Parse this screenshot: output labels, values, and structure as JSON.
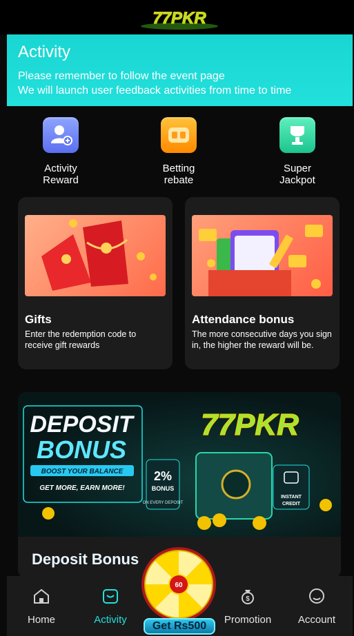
{
  "header": {
    "logo_text": "77PKR"
  },
  "hero": {
    "title": "Activity",
    "line1": "Please remember to follow the event page",
    "line2": "We will launch user feedback activities from time to time"
  },
  "quick_links": [
    {
      "label_line1": "Activity",
      "label_line2": "Reward",
      "icon": "user-add-icon",
      "color": "#6f86ff"
    },
    {
      "label_line1": "Betting",
      "label_line2": "rebate",
      "icon": "rebate-icon",
      "color": "#ff9c1a"
    },
    {
      "label_line1": "Super",
      "label_line2": "Jackpot",
      "icon": "trophy-icon",
      "color": "#2fd9a6"
    }
  ],
  "cards": [
    {
      "title": "Gifts",
      "desc": "Enter the redemption code to receive gift rewards"
    },
    {
      "title": "Attendance bonus",
      "desc": "The more consecutive days you sign in, the higher the reward will be."
    }
  ],
  "promo": {
    "banner": {
      "headline1": "DEPOSIT",
      "headline2": "BONUS",
      "tagline": "BOOST YOUR BALANCE",
      "subline": "GET MORE, EARN MORE!",
      "brand": "77PKR",
      "percent": "2%",
      "bonus_word": "BONUS",
      "every_deposit": "ON EVERY DEPOSIT",
      "instant": "INSTANT",
      "credit": "CREDIT"
    },
    "title": "Deposit Bonus"
  },
  "wheel": {
    "center_value": "60",
    "button_label": "Get Rs500"
  },
  "nav": {
    "home": "Home",
    "activity": "Activity",
    "promotion": "Promotion",
    "account": "Account"
  },
  "colors": {
    "accent": "#22e0dc",
    "gold": "#f2c200",
    "card_bg": "#1c1c1c"
  }
}
